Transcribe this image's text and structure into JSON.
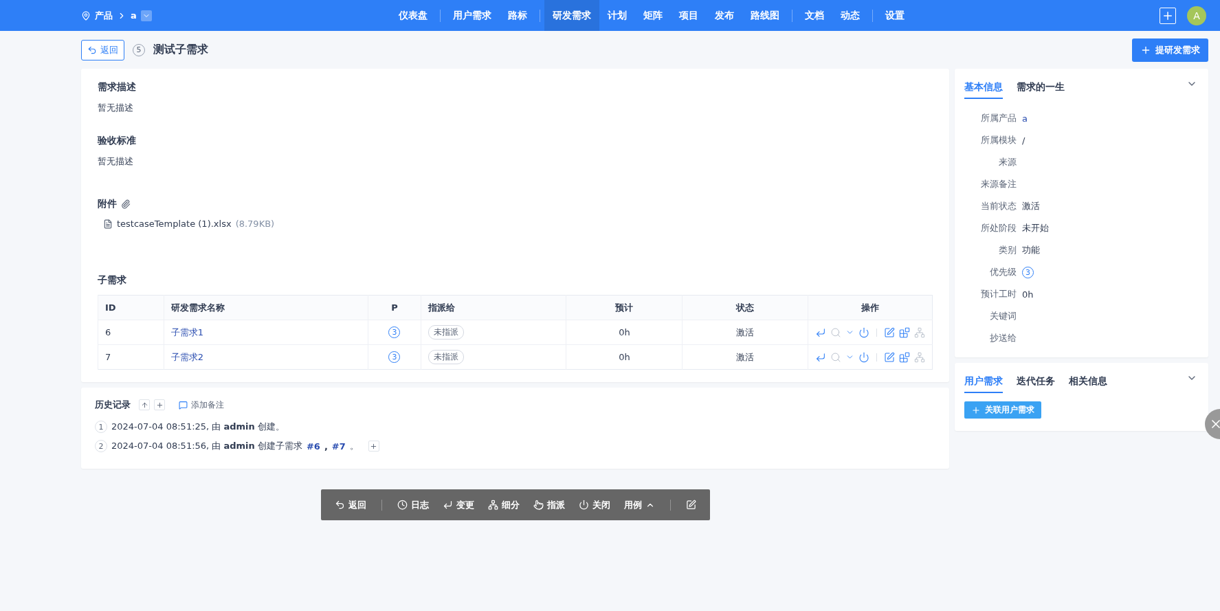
{
  "nav": {
    "product_label": "产品",
    "product_value": "a",
    "groups": [
      [
        {
          "label": "仪表盘",
          "selected": false
        }
      ],
      [
        {
          "label": "用户需求",
          "selected": false
        },
        {
          "label": "路标",
          "selected": false
        }
      ],
      [
        {
          "label": "研发需求",
          "selected": true
        },
        {
          "label": "计划",
          "selected": false
        },
        {
          "label": "矩阵",
          "selected": false
        },
        {
          "label": "项目",
          "selected": false
        },
        {
          "label": "发布",
          "selected": false
        },
        {
          "label": "路线图",
          "selected": false
        }
      ],
      [
        {
          "label": "文档",
          "selected": false
        },
        {
          "label": "动态",
          "selected": false
        }
      ],
      [
        {
          "label": "设置",
          "selected": false
        }
      ]
    ],
    "avatar": "A"
  },
  "header": {
    "back": "返回",
    "id": "5",
    "title": "测试子需求",
    "create_button": "提研发需求"
  },
  "sections": [
    {
      "title": "需求描述",
      "body": "暂无描述"
    },
    {
      "title": "验收标准",
      "body": "暂无描述"
    }
  ],
  "attachments": {
    "title": "附件",
    "files": [
      {
        "name": "testcaseTemplate (1).xlsx",
        "size": "(8.79KB)"
      }
    ]
  },
  "children": {
    "title": "子需求",
    "columns": [
      "ID",
      "研发需求名称",
      "P",
      "指派给",
      "预计",
      "状态",
      "操作"
    ],
    "rows": [
      {
        "id": "6",
        "name": "子需求1",
        "priority": "3",
        "assigned": "未指派",
        "estimate": "0h",
        "status": "激活",
        "actions": [
          {
            "kind": "change",
            "disabled": false
          },
          {
            "kind": "search",
            "disabled": true
          },
          {
            "kind": "caret",
            "disabled": false
          },
          {
            "kind": "close",
            "disabled": false
          },
          {
            "kind": "sep"
          },
          {
            "kind": "edit",
            "disabled": false
          },
          {
            "kind": "batch",
            "disabled": false
          },
          {
            "kind": "tree",
            "disabled": true
          }
        ]
      },
      {
        "id": "7",
        "name": "子需求2",
        "priority": "3",
        "assigned": "未指派",
        "estimate": "0h",
        "status": "激活",
        "actions": [
          {
            "kind": "change",
            "disabled": false
          },
          {
            "kind": "search",
            "disabled": true
          },
          {
            "kind": "caret",
            "disabled": false
          },
          {
            "kind": "close",
            "disabled": false
          },
          {
            "kind": "sep"
          },
          {
            "kind": "edit",
            "disabled": false
          },
          {
            "kind": "batch",
            "disabled": false
          },
          {
            "kind": "tree",
            "disabled": true
          }
        ]
      }
    ]
  },
  "history": {
    "title": "历史记录",
    "add_note": "添加备注",
    "entries": [
      {
        "index": "1",
        "text": "2024-07-04 08:51:25, 由 **admin** 创建。",
        "expandable": false
      },
      {
        "index": "2",
        "text": "2024-07-04 08:51:56, 由 **admin** 创建子需求",
        "links": [
          "#6",
          "#7"
        ],
        "link_separator": ",",
        "suffix": "。",
        "expandable": true
      }
    ]
  },
  "toolbar": [
    {
      "kind": "back",
      "label": "返回"
    },
    {
      "kind": "sep"
    },
    {
      "kind": "log",
      "label": "日志"
    },
    {
      "kind": "change",
      "label": "变更"
    },
    {
      "kind": "split",
      "label": "细分"
    },
    {
      "kind": "assign",
      "label": "指派"
    },
    {
      "kind": "close",
      "label": "关闭"
    },
    {
      "kind": "menu",
      "label": "用例"
    },
    {
      "kind": "sep"
    },
    {
      "kind": "edit"
    }
  ],
  "info_panel": {
    "tabs": [
      {
        "label": "基本信息",
        "selected": true
      },
      {
        "label": "需求的一生",
        "selected": false
      }
    ],
    "fields": [
      {
        "label": "所属产品",
        "value": "a",
        "kind": "link"
      },
      {
        "label": "所属模块",
        "value": "/",
        "kind": "text"
      },
      {
        "label": "来源",
        "kind": "text"
      },
      {
        "label": "来源备注",
        "kind": "text"
      },
      {
        "label": "当前状态",
        "value": "激活",
        "kind": "text"
      },
      {
        "label": "所处阶段",
        "value": "未开始",
        "kind": "text"
      },
      {
        "label": "类别",
        "value": "功能",
        "kind": "text"
      },
      {
        "label": "优先级",
        "value": "3",
        "kind": "priority"
      },
      {
        "label": "预计工时",
        "value": "0h",
        "kind": "text"
      },
      {
        "label": "关键词",
        "kind": "text"
      },
      {
        "label": "抄送给",
        "kind": "text"
      }
    ]
  },
  "relation_panel": {
    "tabs": [
      {
        "label": "用户需求",
        "selected": true
      },
      {
        "label": "迭代任务",
        "selected": false
      },
      {
        "label": "相关信息",
        "selected": false
      }
    ],
    "button": "关联用户需求"
  }
}
